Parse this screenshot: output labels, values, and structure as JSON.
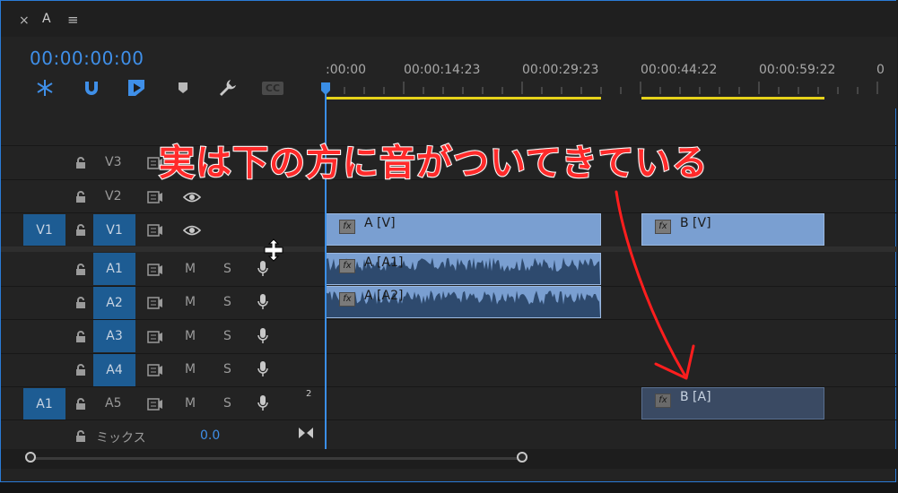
{
  "panel": {
    "close_glyph": "×",
    "title": "A",
    "menu_glyph": "≡"
  },
  "timecode": "00:00:00:00",
  "tools": [
    {
      "icon": "snap-insert-icon"
    },
    {
      "icon": "magnet-icon"
    },
    {
      "icon": "linked-selection-icon"
    },
    {
      "icon": "marker-icon"
    },
    {
      "icon": "wrench-icon"
    },
    {
      "icon": "captions-icon",
      "text": "CC"
    }
  ],
  "ruler": {
    "labels": [
      ":00:00",
      "00:00:14:23",
      "00:00:29:23",
      "00:00:44:22",
      "00:00:59:22",
      "0"
    ]
  },
  "tracks": {
    "video": [
      {
        "name": "V3",
        "source": ""
      },
      {
        "name": "V2",
        "source": ""
      },
      {
        "name": "V1",
        "source": "V1"
      }
    ],
    "audio": [
      {
        "name": "A1",
        "source": "",
        "m": "M",
        "s": "S"
      },
      {
        "name": "A2",
        "source": "",
        "m": "M",
        "s": "S"
      },
      {
        "name": "A3",
        "source": "",
        "m": "M",
        "s": "S"
      },
      {
        "name": "A4",
        "source": "",
        "m": "M",
        "s": "S"
      },
      {
        "name": "A5",
        "source": "A1",
        "m": "M",
        "s": "S",
        "badge": "2"
      }
    ],
    "mix": {
      "label": "ミックス",
      "value": "0.0"
    }
  },
  "clips": {
    "a_v": "A [V]",
    "b_v": "B [V]",
    "a_a1": "A [A1]",
    "a_a2": "A [A2]",
    "b_a": "B [A]",
    "fx": "fx"
  },
  "annotation": {
    "text": "実は下の方に音がついてきている",
    "color": "#ff2a2a"
  },
  "colors": {
    "accent": "#2a7bd6",
    "timecode": "#3f8fe8",
    "clip_video": "#7a9fd1",
    "clip_audio_selected": "#7a9fd1",
    "clip_audio_unselected": "#3a4a63",
    "work_area": "#e6d21a",
    "playhead": "#3a8ee6"
  }
}
